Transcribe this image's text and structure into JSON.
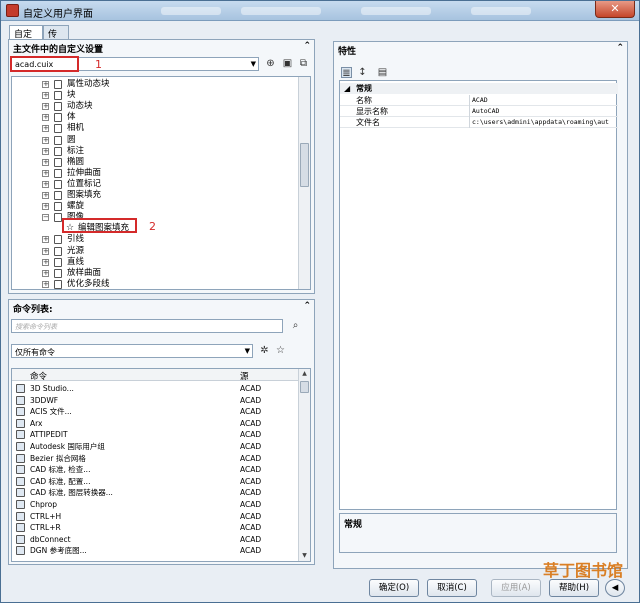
{
  "window": {
    "title": "自定义用户界面",
    "close_glyph": "✕"
  },
  "tabs": [
    {
      "label": "自定义"
    },
    {
      "label": "传输"
    }
  ],
  "left_top": {
    "header": "主文件中的自定义设置",
    "collapse_glyph": "⌃",
    "file_value": "acad.cuix",
    "annotation_1": "1",
    "tree": [
      {
        "label": "属性动态块"
      },
      {
        "label": "块"
      },
      {
        "label": "动态块"
      },
      {
        "label": "体"
      },
      {
        "label": "相机"
      },
      {
        "label": "圆"
      },
      {
        "label": "标注"
      },
      {
        "label": "椭圆"
      },
      {
        "label": "拉伸曲面"
      },
      {
        "label": "位置标记"
      },
      {
        "label": "图案填充"
      },
      {
        "label": "螺旋"
      },
      {
        "label": "图像",
        "expanded": true
      },
      {
        "label": "编辑图案填充",
        "child": true
      },
      {
        "label": "引线"
      },
      {
        "label": "光源"
      },
      {
        "label": "直线"
      },
      {
        "label": "放样曲面"
      },
      {
        "label": "优化多段线"
      }
    ],
    "annotation_2": "2"
  },
  "commands": {
    "header": "命令列表:",
    "search_placeholder": "搜索命令列表",
    "filter_value": "仅所有命令",
    "col_command": "命令",
    "col_source": "源",
    "rows": [
      {
        "name": "3D Studio...",
        "src": "ACAD"
      },
      {
        "name": "3DDWF",
        "src": "ACAD"
      },
      {
        "name": "ACIS 文件...",
        "src": "ACAD"
      },
      {
        "name": "Arx",
        "src": "ACAD"
      },
      {
        "name": "ATTIPEDIT",
        "src": "ACAD"
      },
      {
        "name": "Autodesk 国际用户组",
        "src": "ACAD"
      },
      {
        "name": "Bezier 拟合网格",
        "src": "ACAD"
      },
      {
        "name": "CAD 标准, 检查...",
        "src": "ACAD"
      },
      {
        "name": "CAD 标准, 配置...",
        "src": "ACAD"
      },
      {
        "name": "CAD 标准, 图层转换器...",
        "src": "ACAD"
      },
      {
        "name": "Chprop",
        "src": "ACAD"
      },
      {
        "name": "CTRL+H",
        "src": "ACAD"
      },
      {
        "name": "CTRL+R",
        "src": "ACAD"
      },
      {
        "name": "dbConnect",
        "src": "ACAD"
      },
      {
        "name": "DGN 参考底图...",
        "src": "ACAD"
      }
    ]
  },
  "properties": {
    "header": "特性",
    "section": "常规",
    "rows": [
      {
        "name": "名称",
        "value": "ACAD"
      },
      {
        "name": "显示名称",
        "value": "AutoCAD"
      },
      {
        "name": "文件名",
        "value": "c:\\users\\admini\\appdata\\roaming\\aut"
      }
    ],
    "desc_title": "常规"
  },
  "buttons": {
    "ok": "确定(O)",
    "cancel": "取消(C)",
    "apply": "应用(A)",
    "help": "帮助(H)"
  },
  "watermark": "草丁图书馆",
  "colors": {
    "annotation": "#d42a2a",
    "accent": "#4a6f93"
  }
}
